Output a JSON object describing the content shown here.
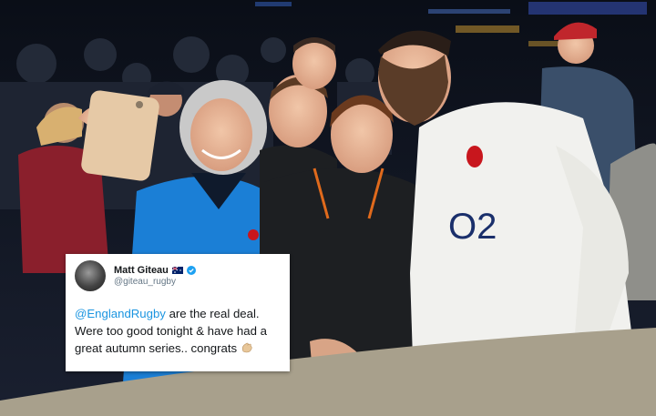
{
  "tweet": {
    "display_name": "Matt Giteau",
    "handle": "@giteau_rugby",
    "mention": "@EnglandRugby",
    "text_line1_rest": " are the real deal.",
    "text_line2": "Were too good tonight & have had a",
    "text_line3": "great autumn series.. congrats",
    "icons": [
      "avatar",
      "australia-flag-icon",
      "verified-icon",
      "clapping-hands-icon"
    ]
  },
  "photo": {
    "jersey_text": "O2",
    "description_colors": {
      "stadium_bg": "#141a27",
      "jacket_blue": "#1b7fd6",
      "jacket_black": "#1d1f22",
      "jersey_white": "#f1f1ee",
      "rose_red": "#c8161d",
      "cap_red": "#c0262c"
    }
  }
}
